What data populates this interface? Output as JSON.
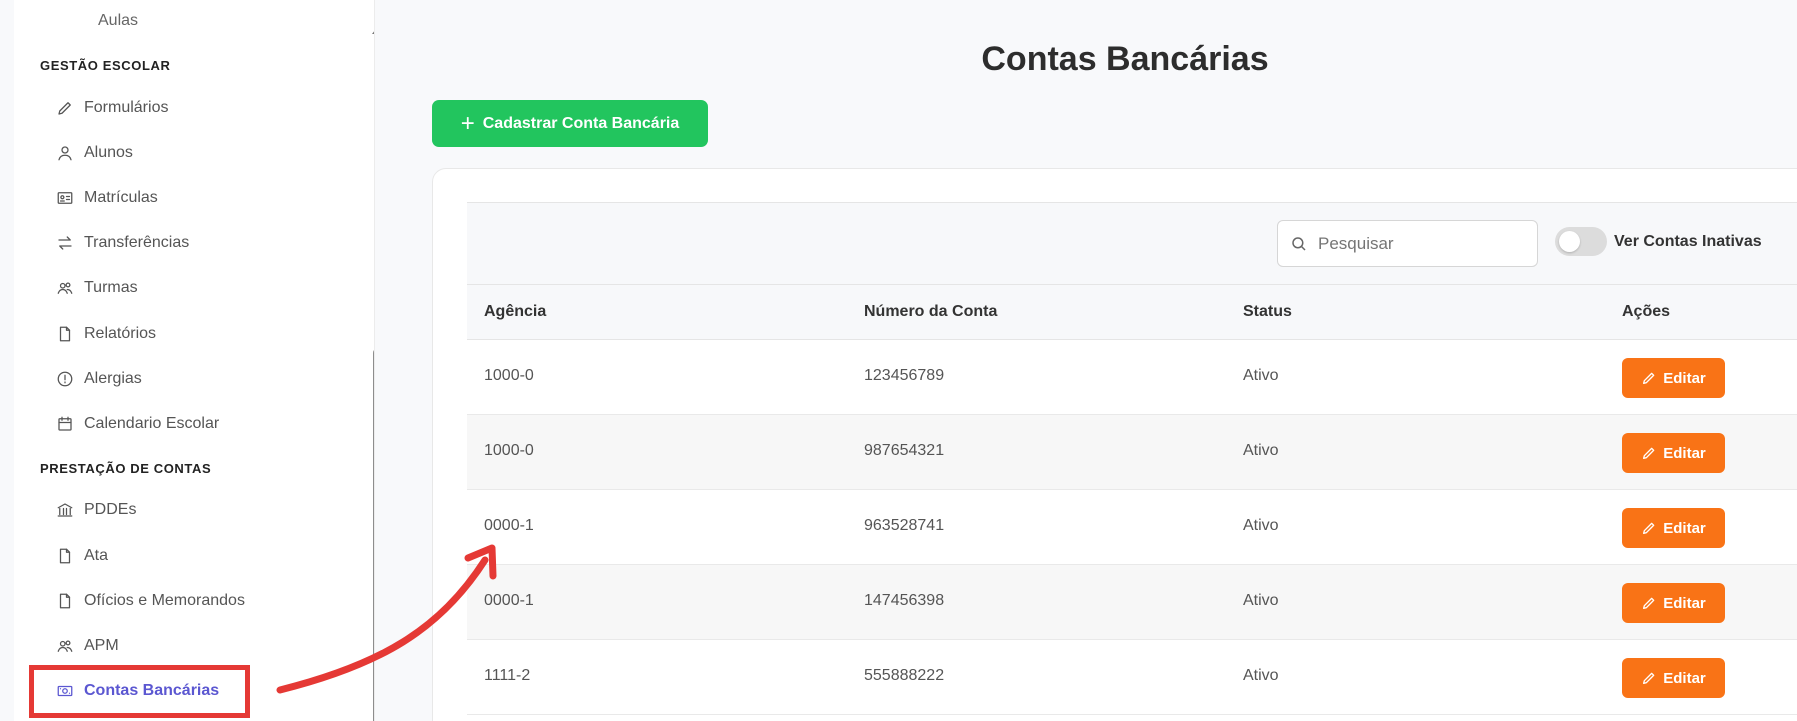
{
  "sidebar": {
    "cut_item": "Aulas",
    "sections": [
      {
        "title": "GESTÃO ESCOLAR",
        "items": [
          {
            "label": "Formulários",
            "icon": "pencil-icon"
          },
          {
            "label": "Alunos",
            "icon": "user-icon"
          },
          {
            "label": "Matrículas",
            "icon": "id-card-icon"
          },
          {
            "label": "Transferências",
            "icon": "arrows-swap-icon"
          },
          {
            "label": "Turmas",
            "icon": "users-icon"
          },
          {
            "label": "Relatórios",
            "icon": "file-icon"
          },
          {
            "label": "Alergias",
            "icon": "alert-circle-icon"
          },
          {
            "label": "Calendario Escolar",
            "icon": "calendar-icon"
          }
        ]
      },
      {
        "title": "PRESTAÇÃO DE CONTAS",
        "items": [
          {
            "label": "PDDEs",
            "icon": "bank-icon"
          },
          {
            "label": "Ata",
            "icon": "file-icon"
          },
          {
            "label": "Ofícios e Memorandos",
            "icon": "file-icon"
          },
          {
            "label": "APM",
            "icon": "users-icon"
          },
          {
            "label": "Contas Bancárias",
            "icon": "money-icon",
            "active": true
          }
        ]
      }
    ]
  },
  "page": {
    "title": "Contas Bancárias",
    "add_button": "Cadastrar Conta Bancária"
  },
  "toolbar": {
    "search_placeholder": "Pesquisar",
    "toggle_label": "Ver Contas Inativas",
    "toggle_on": false
  },
  "table": {
    "headers": [
      "Agência",
      "Número da Conta",
      "Status",
      "Ações"
    ],
    "rows": [
      {
        "agencia": "1000-0",
        "numero": "123456789",
        "status": "Ativo",
        "action": "Editar"
      },
      {
        "agencia": "1000-0",
        "numero": "987654321",
        "status": "Ativo",
        "action": "Editar"
      },
      {
        "agencia": "0000-1",
        "numero": "963528741",
        "status": "Ativo",
        "action": "Editar"
      },
      {
        "agencia": "0000-1",
        "numero": "147456398",
        "status": "Ativo",
        "action": "Editar"
      },
      {
        "agencia": "1111-2",
        "numero": "555888222",
        "status": "Ativo",
        "action": "Editar"
      }
    ]
  },
  "colors": {
    "primary_green": "#22c55e",
    "edit_orange": "#f97316",
    "active_nav": "#5b57d1",
    "highlight_red": "#e53935"
  }
}
